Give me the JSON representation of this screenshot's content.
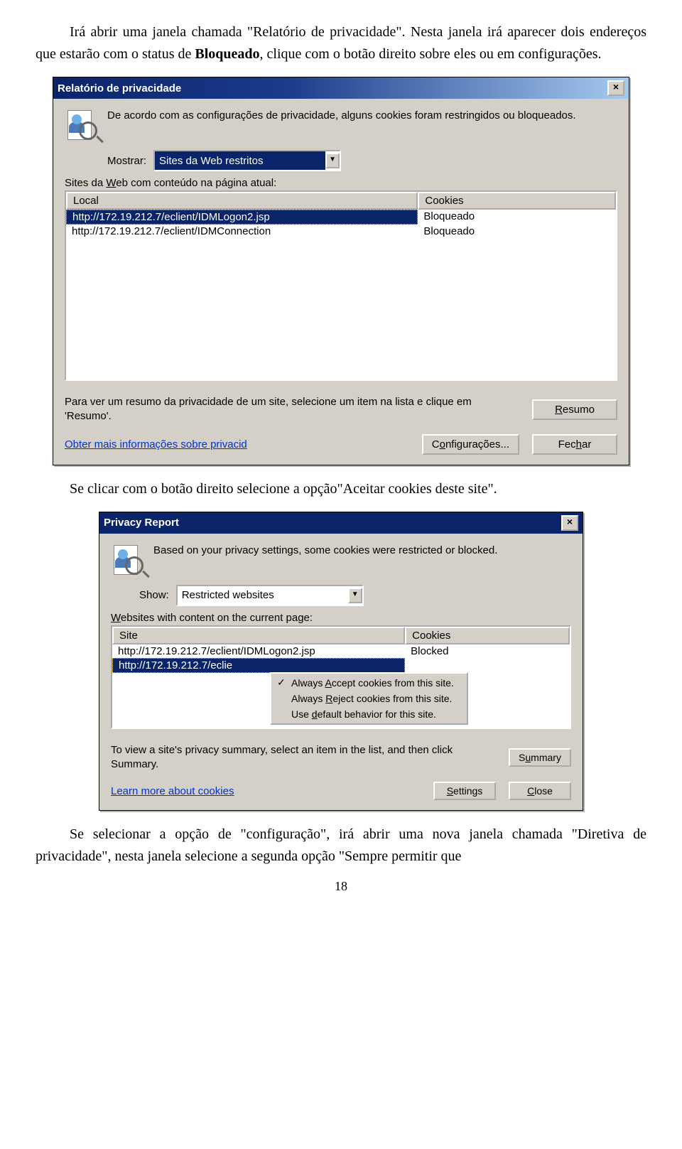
{
  "para1_a": "Irá abrir uma janela chamada \"Relatório de privacidade\". Nesta janela irá aparecer dois endereços que estarão com o status de ",
  "para1_b": "Bloqueado",
  "para1_c": ", clique com o botão direito sobre eles ou em configurações.",
  "para2": "Se clicar com o botão direito selecione a opção\"Aceitar cookies deste site\".",
  "para3": "Se selecionar a opção de \"configuração\", irá abrir uma nova janela chamada \"Diretiva de privacidade\", nesta janela selecione a segunda opção \"Sempre permitir que",
  "page_number": "18",
  "dialog1": {
    "title": "Relatório de privacidade",
    "intro": "De acordo com as configurações de privacidade, alguns cookies foram restringidos ou bloqueados.",
    "show_label": "Mostrar:",
    "show_value": "Sites da Web restritos",
    "sites_label_a": "Sites da ",
    "sites_label_u": "W",
    "sites_label_b": "eb com conteúdo na página atual:",
    "col_site": "Local",
    "col_cookies": "Cookies",
    "rows": [
      {
        "site": "http://172.19.212.7/eclient/IDMLogon2.jsp",
        "status": "Bloqueado"
      },
      {
        "site": "http://172.19.212.7/eclient/IDMConnection",
        "status": "Bloqueado"
      }
    ],
    "hint": "Para ver um resumo da privacidade de um site, selecione um item na lista e clique em 'Resumo'.",
    "link": "Obter mais informações sobre privacid",
    "btn_summary_u": "R",
    "btn_summary_rest": "esumo",
    "btn_settings_a": "C",
    "btn_settings_u": "o",
    "btn_settings_b": "nfigurações...",
    "btn_close_a": "Fec",
    "btn_close_u": "h",
    "btn_close_b": "ar",
    "close_x": "×"
  },
  "dialog2": {
    "title": "Privacy Report",
    "intro": "Based on your privacy settings, some cookies were restricted or blocked.",
    "show_label": "Show:",
    "show_value": "Restricted websites",
    "sites_label_u": "W",
    "sites_label_b": "ebsites with content on the current page:",
    "col_site": "Site",
    "col_cookies": "Cookies",
    "rows": [
      {
        "site": "http://172.19.212.7/eclient/IDMLogon2.jsp",
        "status": "Blocked"
      },
      {
        "site": "http://172.19.212.7/eclie",
        "status": ""
      }
    ],
    "ctx": {
      "accept_a": "Always ",
      "accept_u": "A",
      "accept_b": "ccept cookies from this site.",
      "reject_a": "Always ",
      "reject_u": "R",
      "reject_b": "eject cookies from this site.",
      "default_a": "Use ",
      "default_u": "d",
      "default_b": "efault behavior for this site."
    },
    "hint": "To view a site's privacy summary, select an item in the list, and then click Summary.",
    "link": "Learn more about cookies",
    "btn_summary_a": "S",
    "btn_summary_u": "u",
    "btn_summary_b": "mmary",
    "btn_settings_u": "S",
    "btn_settings_b": "ettings",
    "btn_close_u": "C",
    "btn_close_b": "lose",
    "close_x": "×"
  }
}
